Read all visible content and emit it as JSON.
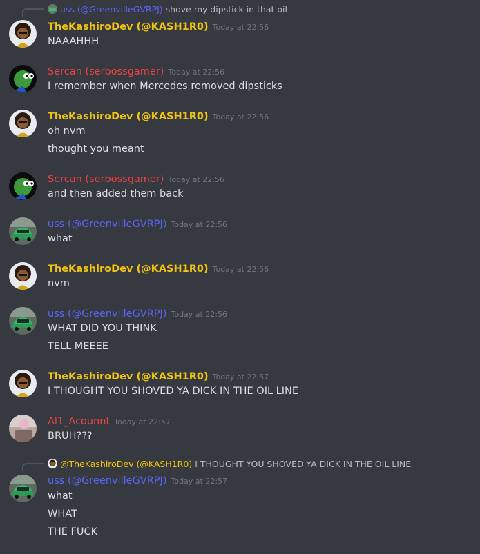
{
  "users": {
    "kash": "TheKashiroDev (@KASH1R0)",
    "sercan": "Sercan (serbossgamer)",
    "uss": "uss (@GreenvilleGVRPJ)",
    "al": "Al1_Acounnt"
  },
  "colors": {
    "background": "#36393f",
    "kash": "#f1c40f",
    "sercan": "#ed4245",
    "uss": "#5865f2",
    "al": "#ed4245",
    "text": "#dcddde",
    "timestamp": "#72767d"
  },
  "reply1": {
    "author": "uss (@GreenvilleGVRPJ)",
    "text": "shove my dipstick in that oil"
  },
  "messages": [
    {
      "author": "TheKashiroDev (@KASH1R0)",
      "time": "Today at 22:56",
      "lines": [
        "NAAAHHH"
      ]
    },
    {
      "author": "Sercan (serbossgamer)",
      "time": "Today at 22:56",
      "lines": [
        "I remember when Mercedes removed dipsticks"
      ]
    },
    {
      "author": "TheKashiroDev (@KASH1R0)",
      "time": "Today at 22:56",
      "lines": [
        "oh nvm",
        "thought you meant"
      ]
    },
    {
      "author": "Sercan (serbossgamer)",
      "time": "Today at 22:56",
      "lines": [
        "and then added them back"
      ]
    },
    {
      "author": "uss (@GreenvilleGVRPJ)",
      "time": "Today at 22:56",
      "lines": [
        "what"
      ]
    },
    {
      "author": "TheKashiroDev (@KASH1R0)",
      "time": "Today at 22:56",
      "lines": [
        "nvm"
      ]
    },
    {
      "author": "uss (@GreenvilleGVRPJ)",
      "time": "Today at 22:56",
      "lines": [
        "WHAT DID YOU THINK",
        "TELL MEEEE"
      ]
    },
    {
      "author": "TheKashiroDev (@KASH1R0)",
      "time": "Today at 22:57",
      "lines": [
        "I THOUGHT YOU SHOVED YA DICK IN THE OIL LINE"
      ]
    },
    {
      "author": "Al1_Acounnt",
      "time": "Today at 22:57",
      "lines": [
        "BRUH???"
      ]
    },
    {
      "author": "uss (@GreenvilleGVRPJ)",
      "time": "Today at 22:57",
      "lines": [
        "what",
        "WHAT",
        "THE FUCK"
      ]
    }
  ],
  "reply2": {
    "author": "@TheKashiroDev (@KASH1R0)",
    "text": "I THOUGHT YOU SHOVED YA DICK IN THE OIL LINE"
  },
  "icons": {
    "kash": "cartoon-avatar-icon",
    "sercan": "frog-avatar-icon",
    "uss": "car-avatar-icon",
    "al": "photo-avatar-icon"
  }
}
